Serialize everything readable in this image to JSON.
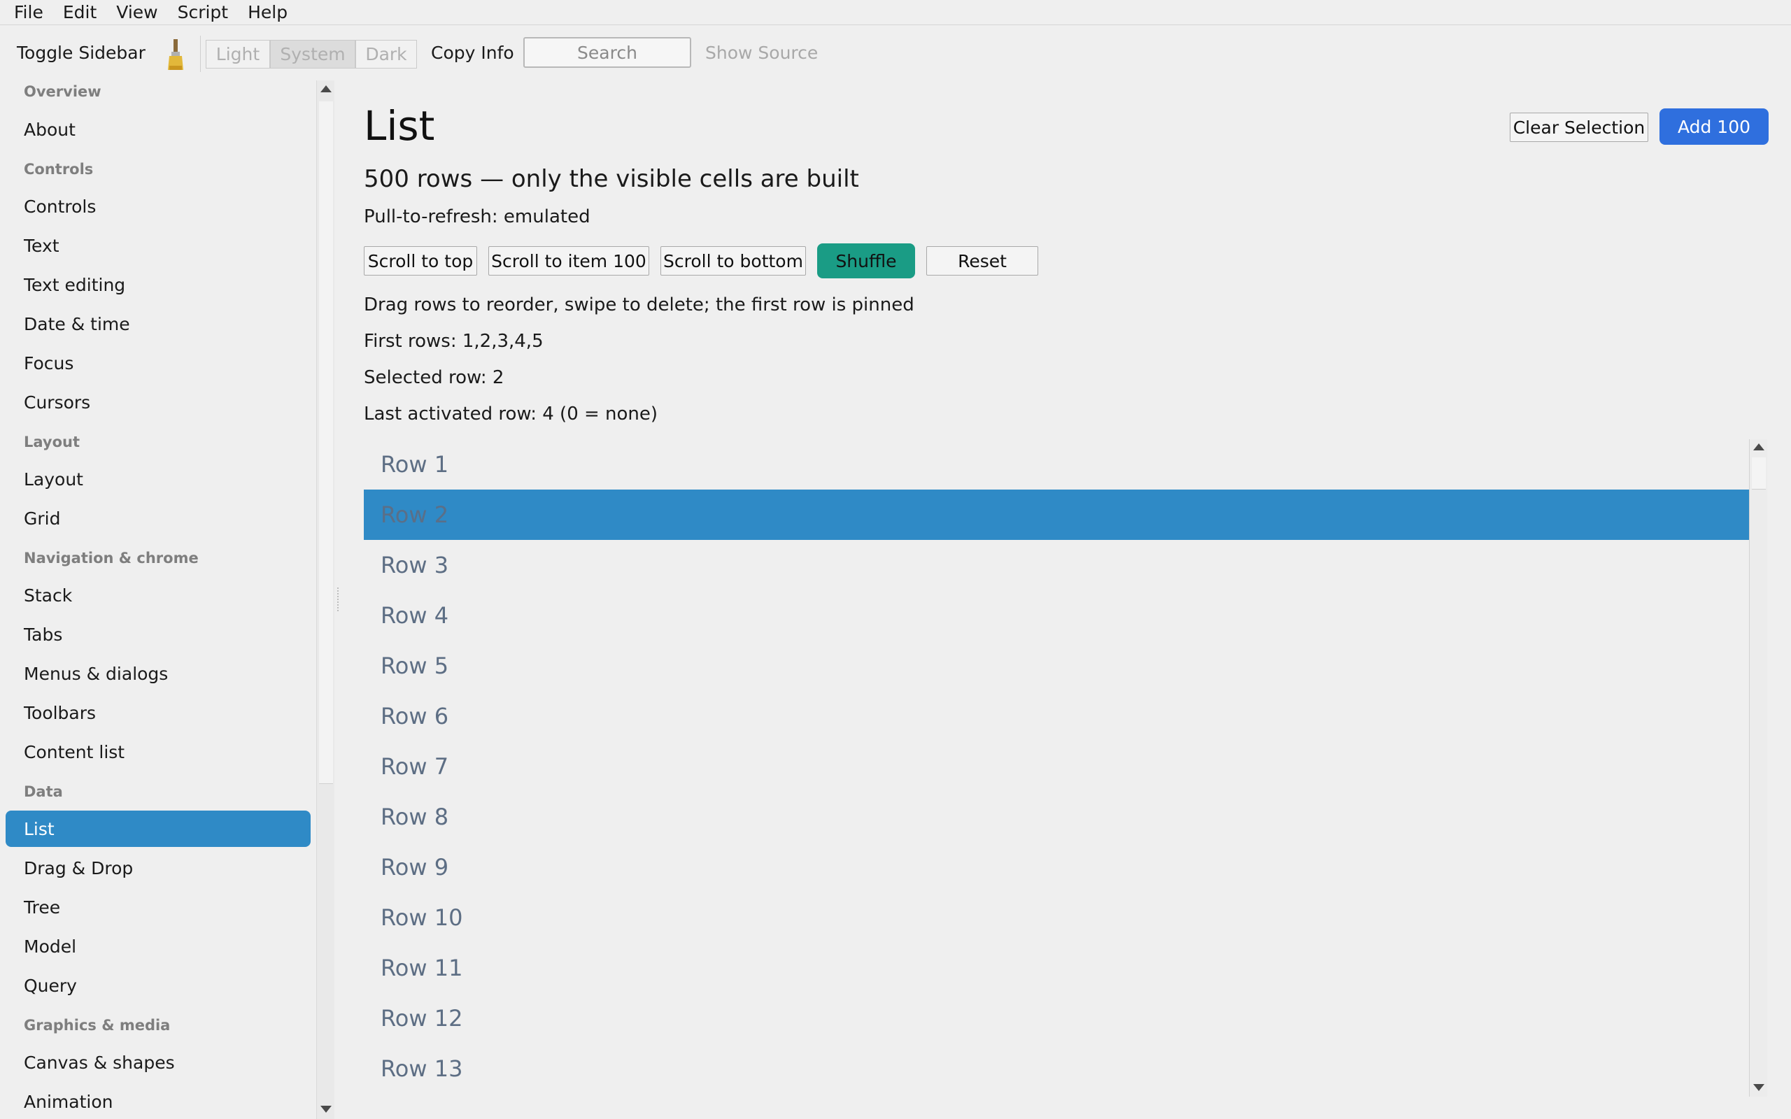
{
  "menu": [
    "File",
    "Edit",
    "View",
    "Script",
    "Help"
  ],
  "toolbar": {
    "toggle_sidebar": "Toggle Sidebar",
    "theme": [
      "Light",
      "System",
      "Dark"
    ],
    "theme_selected": "System",
    "copy_info": "Copy Info",
    "search_placeholder": "Search",
    "show_source": "Show Source"
  },
  "sidebar": {
    "sections": [
      {
        "label": "Overview",
        "items": [
          "About"
        ]
      },
      {
        "label": "Controls",
        "items": [
          "Controls",
          "Text",
          "Text editing",
          "Date & time",
          "Focus",
          "Cursors"
        ]
      },
      {
        "label": "Layout",
        "items": [
          "Layout",
          "Grid"
        ]
      },
      {
        "label": "Navigation & chrome",
        "items": [
          "Stack",
          "Tabs",
          "Menus & dialogs",
          "Toolbars",
          "Content list"
        ]
      },
      {
        "label": "Data",
        "items": [
          "List",
          "Drag & Drop",
          "Tree",
          "Model",
          "Query"
        ]
      },
      {
        "label": "Graphics & media",
        "items": [
          "Canvas & shapes",
          "Animation"
        ]
      }
    ],
    "selected": "List",
    "colors": {
      "selected_bg": "#2f8ac6"
    }
  },
  "main": {
    "title": "List",
    "clear_selection": "Clear Selection",
    "add_100": "Add 100",
    "subtitle": "500 rows — only the visible cells are built",
    "pull_to_refresh": "Pull-to-refresh: emulated",
    "actions": {
      "scroll_top": "Scroll to top",
      "scroll_100": "Scroll to item 100",
      "scroll_bottom": "Scroll to bottom",
      "shuffle": "Shuffle",
      "reset": "Reset"
    },
    "hint": "Drag rows to reorder, swipe to delete; the first row is pinned",
    "first_rows": "First rows: 1,2,3,4,5",
    "selected_row": "Selected row: 2",
    "last_activated": "Last activated row: 4 (0 = none)",
    "rows": [
      "Row 1",
      "Row 2",
      "Row 3",
      "Row 4",
      "Row 5",
      "Row 6",
      "Row 7",
      "Row 8",
      "Row 9",
      "Row 10",
      "Row 11",
      "Row 12",
      "Row 13"
    ],
    "selected_row_index": 1,
    "colors": {
      "primary": "#2f6fde",
      "teal": "#1a9c85",
      "row_text": "#5d6e84"
    }
  }
}
